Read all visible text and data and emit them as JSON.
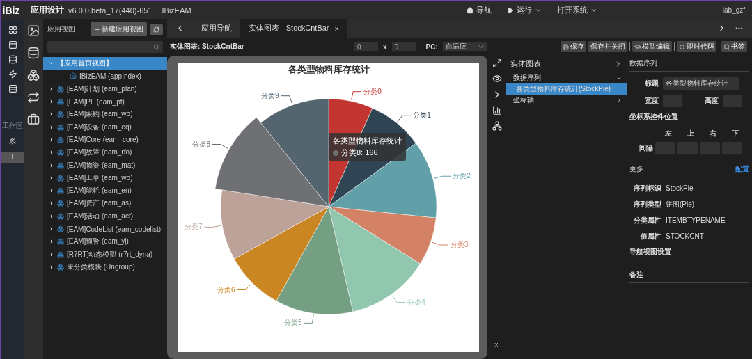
{
  "app_bar": {
    "logo": "iBiz",
    "title": "应用设计",
    "version": "v6.0.0.beta_17(440)-651",
    "project": "IBizEAM",
    "menu": [
      {
        "label": "导航",
        "kind": "home",
        "dropdown": false
      },
      {
        "label": "运行",
        "kind": "run",
        "dropdown": true
      },
      {
        "label": "打开系统",
        "kind": "plain",
        "dropdown": true
      }
    ],
    "user": "lab_gzf"
  },
  "activity_bar": {
    "workspace_label": "工作区",
    "system_label": "系",
    "tab": {
      "label": "I",
      "selected": true
    }
  },
  "tree_panel": {
    "title": "应用视图",
    "new_button": "新建应用视图",
    "items": [
      {
        "label": "【应用首页视图】",
        "expanded": true,
        "selected": true,
        "kind": "group",
        "children": [
          {
            "label": "IBizEAM (appIndex)",
            "kind": "home",
            "selected": false
          }
        ]
      },
      {
        "label": "[EAM]计划 (eam_plan)",
        "expanded": false,
        "selected": false,
        "kind": "module"
      },
      {
        "label": "[EAM]PF (eam_pf)",
        "expanded": false,
        "selected": false,
        "kind": "module"
      },
      {
        "label": "[EAM]采购 (eam_wp)",
        "expanded": false,
        "selected": false,
        "kind": "module"
      },
      {
        "label": "[EAM]设备 (eam_eq)",
        "expanded": false,
        "selected": false,
        "kind": "module"
      },
      {
        "label": "[EAM]Core (eam_core)",
        "expanded": false,
        "selected": false,
        "kind": "module"
      },
      {
        "label": "[EAM]故障 (eam_rfo)",
        "expanded": false,
        "selected": false,
        "kind": "module"
      },
      {
        "label": "[EAM]物资 (eam_mat)",
        "expanded": false,
        "selected": false,
        "kind": "module"
      },
      {
        "label": "[EAM]工单 (eam_wo)",
        "expanded": false,
        "selected": false,
        "kind": "module"
      },
      {
        "label": "[EAM]能耗 (eam_en)",
        "expanded": false,
        "selected": false,
        "kind": "module"
      },
      {
        "label": "[EAM]资产 (eam_as)",
        "expanded": false,
        "selected": false,
        "kind": "module"
      },
      {
        "label": "[EAM]活动 (eam_act)",
        "expanded": false,
        "selected": false,
        "kind": "module"
      },
      {
        "label": "[EAM]CodeList (eam_codelist)",
        "expanded": false,
        "selected": false,
        "kind": "module"
      },
      {
        "label": "[EAM]预警 (eam_yj)",
        "expanded": false,
        "selected": false,
        "kind": "module"
      },
      {
        "label": "[R7RT]动态模型 (r7rt_dyna)",
        "expanded": false,
        "selected": false,
        "kind": "module"
      },
      {
        "label": "未分类模块 (Ungroup)",
        "expanded": false,
        "selected": false,
        "kind": "module"
      }
    ]
  },
  "tabs": [
    {
      "label": "应用导航",
      "selected": false
    },
    {
      "label": "实体图表 - StockCntBar",
      "selected": true,
      "close": "×"
    }
  ],
  "toolbar": {
    "title": "实体图表: StockCntBar",
    "x_value": "0",
    "times": "x",
    "y_value": "0",
    "pc_label": "PC:",
    "pc_value": "自适应",
    "buttons": [
      {
        "label": "保存",
        "kind": "save",
        "separator_before": false
      },
      {
        "label": "保存并关闭",
        "kind": "plain",
        "separator_before": false
      },
      {
        "label": "模型编辑",
        "kind": "cap",
        "separator_before": true
      },
      {
        "label": "即时代码",
        "kind": "code",
        "separator_before": true
      },
      {
        "label": "书签",
        "kind": "bookmark",
        "separator_before": true
      }
    ]
  },
  "chart": {
    "title": "各类型物料库存统计",
    "slices": [
      {
        "label": "分类0",
        "color": "#c23531",
        "selected": false
      },
      {
        "label": "分类1",
        "color": "#2f4554",
        "selected": false
      },
      {
        "label": "分类2",
        "color": "#61a0a8",
        "selected": false
      },
      {
        "label": "分类3",
        "color": "#d48265",
        "selected": false
      },
      {
        "label": "分类4",
        "color": "#91c7ae",
        "selected": false
      },
      {
        "label": "分类5",
        "color": "#749f83",
        "selected": false
      },
      {
        "label": "分类6",
        "color": "#ca8622",
        "selected": false
      },
      {
        "label": "分类7",
        "color": "#bda29a",
        "selected": false
      },
      {
        "label": "分类8",
        "color": "#6e7074",
        "selected": true
      },
      {
        "label": "分类9",
        "color": "#546570",
        "selected": false
      }
    ],
    "tooltip": {
      "title": "各类型物料库存统计",
      "text": "分类8: 166"
    }
  },
  "outline": {
    "title": "实体图表",
    "items": [
      {
        "label": "数据序列",
        "expanded": true,
        "children": [
          {
            "label": "各类型物料库存统计(StockPie)",
            "selected": true
          }
        ]
      },
      {
        "label": "坐标轴",
        "expanded": false
      }
    ]
  },
  "properties": {
    "section": "数据序列",
    "title_label": "标题",
    "title_value": "各类型物料库存统计",
    "width_label": "宽度",
    "height_label": "高度",
    "position_heading": "坐标系控件位置",
    "sides": [
      "左",
      "上",
      "右",
      "下"
    ],
    "spacing_label": "间隔",
    "more_heading": "更多",
    "config_link": "配置",
    "fields": [
      {
        "label": "序列标识",
        "value": "StockPie"
      },
      {
        "label": "序列类型",
        "value": "饼图(Pie)"
      },
      {
        "label": "分类属性",
        "value": "ITEMBTYPENAME"
      },
      {
        "label": "值属性",
        "value": "STOCKCNT"
      }
    ],
    "nav_heading": "导航视图设置",
    "notes_heading": "备注"
  }
}
